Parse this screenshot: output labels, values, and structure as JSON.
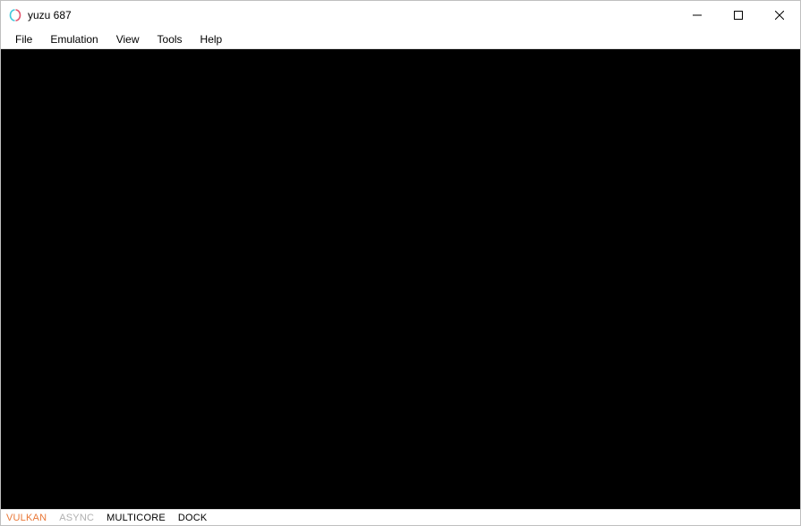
{
  "window": {
    "title": "yuzu 687"
  },
  "menu": {
    "items": [
      "File",
      "Emulation",
      "View",
      "Tools",
      "Help"
    ]
  },
  "statusbar": {
    "vulkan": "VULKAN",
    "async": "ASYNC",
    "multicore": "MULTICORE",
    "dock": "DOCK"
  }
}
